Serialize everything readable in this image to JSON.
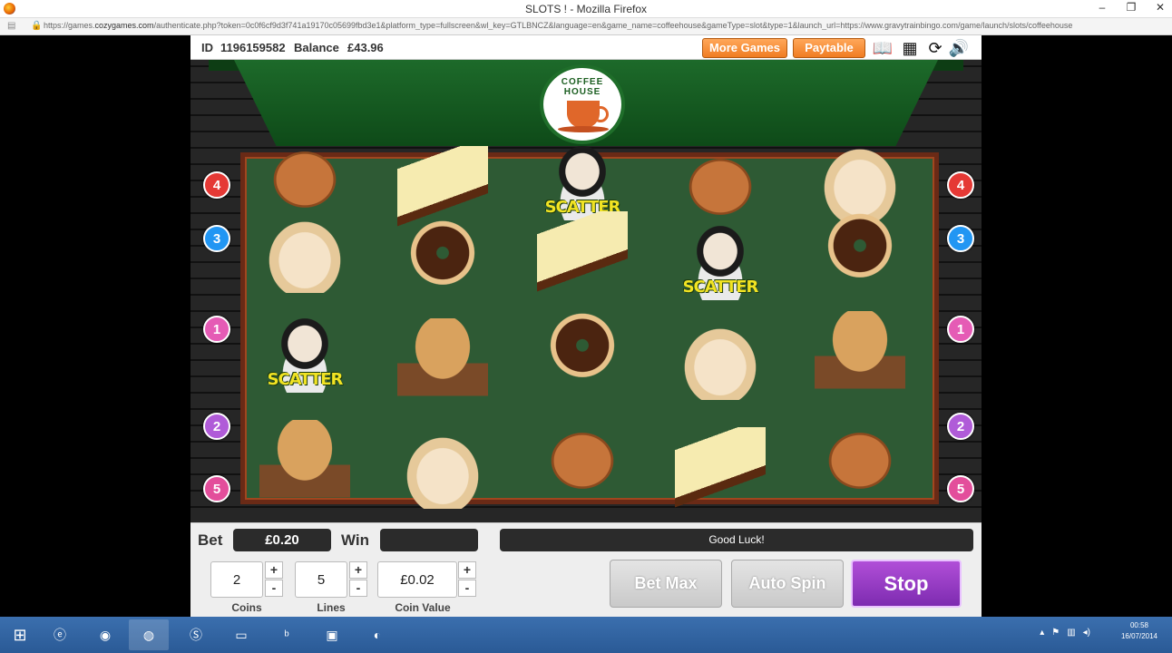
{
  "window": {
    "title": "SLOTS ! - Mozilla Firefox",
    "url_prefix": "https://games.",
    "url_domain": "cozygames.com",
    "url_rest": "/authenticate.php?token=0c0f6cf9d3f741a19170c05699fbd3e1&platform_type=fullscreen&wl_key=GTLBNCZ&language=en&game_name=coffeehouse&gameType=slot&type=1&launch_url=https://www.gravytrainbingo.com/game/launch/slots/coffeehouse",
    "controls": [
      "–",
      "❐",
      "✕"
    ]
  },
  "topbar": {
    "id_label": "ID",
    "id_value": "1196159582",
    "balance_label": "Balance",
    "balance_value": "£43.96",
    "more_games": "More Games",
    "paytable": "Paytable",
    "icons": [
      "book-icon",
      "calculator-icon",
      "refresh-icon",
      "sound-icon"
    ]
  },
  "logo": {
    "text": "COFFEE HOUSE"
  },
  "paylines": {
    "left": [
      "4",
      "3",
      "1",
      "2",
      "5"
    ],
    "right": [
      "4",
      "3",
      "1",
      "2",
      "5"
    ]
  },
  "reels": {
    "scatter_label": "SCATTER",
    "symbols": [
      [
        "cookie",
        "croissant",
        "scatter",
        "muffin"
      ],
      [
        "cake",
        "donut",
        "muffin",
        "croissant"
      ],
      [
        "scatter",
        "cake",
        "donut",
        "cookie"
      ],
      [
        "cookie",
        "scatter",
        "croissant",
        "cake"
      ],
      [
        "croissant",
        "donut",
        "muffin",
        "cookie"
      ]
    ]
  },
  "panel": {
    "bet_label": "Bet",
    "bet_value": "£0.20",
    "win_label": "Win",
    "win_value": "",
    "message": "Good Luck!",
    "coins_value": "2",
    "coins_label": "Coins",
    "lines_value": "5",
    "lines_label": "Lines",
    "coin_value_value": "£0.02",
    "coin_value_label": "Coin Value",
    "plus": "+",
    "minus": "-",
    "bet_max": "Bet Max",
    "auto_spin": "Auto Spin",
    "stop": "Stop"
  },
  "taskbar": {
    "apps": [
      "windows-start-icon",
      "ie-icon",
      "chrome-icon",
      "firefox-icon",
      "skype-icon",
      "app-icon",
      "bing-icon",
      "cp-icon",
      "app-icon-2"
    ],
    "time": "00:58",
    "date": "16/07/2014"
  }
}
